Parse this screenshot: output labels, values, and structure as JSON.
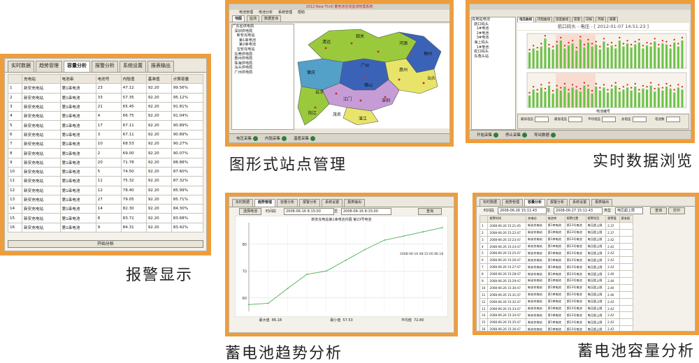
{
  "captions": {
    "alarm": "报警显示",
    "map": "图形式站点管理",
    "realtime": "实时数据浏览",
    "trend": "蓄电池趋势分析",
    "capacity": "蓄电池容量分析"
  },
  "alarm_panel": {
    "tabs": [
      "实时数据",
      "趋势管理",
      "容量分析",
      "报警分析",
      "系统设置",
      "报表输出"
    ],
    "active_tab": 2,
    "headers": [
      "",
      "充电站",
      "电池串",
      "电池号",
      "内阻值",
      "基准值",
      "计算容量"
    ],
    "rows": [
      [
        "1",
        "新安充电站",
        "第1串电池",
        "23",
        "47.12",
        "92.20",
        "99.56%"
      ],
      [
        "2",
        "新安充电站",
        "第1串电池",
        "33",
        "57.35",
        "92.20",
        "95.12%"
      ],
      [
        "3",
        "新安充电站",
        "第1串电池",
        "21",
        "65.45",
        "92.20",
        "91.81%"
      ],
      [
        "4",
        "新安充电站",
        "第1串电池",
        "4",
        "66.75",
        "92.20",
        "91.04%"
      ],
      [
        "5",
        "新安充电站",
        "第1串电池",
        "17",
        "67.11",
        "92.20",
        "90.89%"
      ],
      [
        "6",
        "新安充电站",
        "第1串电池",
        "3",
        "67.11",
        "92.20",
        "90.89%"
      ],
      [
        "7",
        "新安充电站",
        "第1串电池",
        "10",
        "68.53",
        "92.20",
        "90.27%"
      ],
      [
        "8",
        "新安充电站",
        "第1串电池",
        "2",
        "69.00",
        "92.20",
        "90.07%"
      ],
      [
        "9",
        "新安充电站",
        "第1串电池",
        "20",
        "71.78",
        "92.20",
        "88.88%"
      ],
      [
        "10",
        "新安充电站",
        "第1串电池",
        "5",
        "74.50",
        "92.20",
        "87.60%"
      ],
      [
        "11",
        "新安充电站",
        "第1串电池",
        "11",
        "75.32",
        "92.20",
        "87.32%"
      ],
      [
        "12",
        "新安充电站",
        "第1串电池",
        "12",
        "78.40",
        "92.20",
        "85.99%"
      ],
      [
        "13",
        "新安充电站",
        "第1串电池",
        "27",
        "79.05",
        "92.20",
        "85.71%"
      ],
      [
        "14",
        "新安充电站",
        "第1串电池",
        "14",
        "82.30",
        "92.20",
        "84.30%"
      ],
      [
        "15",
        "新安充电站",
        "第1串电池",
        "8",
        "83.72",
        "92.20",
        "83.68%"
      ],
      [
        "16",
        "新安充电站",
        "第1串电池",
        "9",
        "84.31",
        "92.20",
        "83.42%"
      ]
    ],
    "start_button": "开始分析"
  },
  "map_panel": {
    "title": "2012 New Thrill 蓄电池在线监测管理系统",
    "menu": [
      "电池管理",
      "电池分析",
      "系统管理",
      "帮助"
    ],
    "tabs": [
      "地图",
      "监测",
      "数据查询"
    ],
    "tree": [
      "广东省供电局",
      "  深圳供电局",
      "    新安充电站",
      "      第1串电池",
      "      第2串电池",
      "    宝安充电站",
      "  东莞供电局",
      "  惠州供电局",
      "  珠海供电局",
      "  汕头供电局",
      "  广州供电局"
    ],
    "map_labels": [
      "清远",
      "韶关",
      "河源",
      "梅州",
      "肇庆",
      "广州",
      "惠州",
      "汕头",
      "云浮",
      "佛山",
      "江门",
      "深圳",
      "阳江",
      "茂名",
      "湛江"
    ],
    "status_buttons": [
      "电压采集",
      "内阻采集",
      "温度采集"
    ],
    "colors": {
      "sea": "#ffffff",
      "region_a": "#3a63b8",
      "region_b": "#9aca3c",
      "region_c": "#53a0c8",
      "region_d": "#e8e46a",
      "region_e": "#c69cd6"
    }
  },
  "realtime_panel": {
    "tabs": [
      "电压曲线",
      "内阻曲线",
      "温度曲线",
      "容量",
      "日报",
      "月报",
      "报警"
    ],
    "header": "航口码头 - 电压 - [ 2012-01-07 14:51:23 ]",
    "tree": [
      "充电站电池",
      "  航口码头",
      "    1#电池",
      "    2#电池",
      "    3#电池",
      "  海上码头",
      "    1#电池",
      "  蛇口码头",
      "  东角头站"
    ],
    "x_label": "电池编号",
    "fields": [
      "最高电压",
      "最低电压",
      "平均电压",
      "总电压",
      "电池数"
    ],
    "status_buttons": [
      "开始采集",
      "停止采集",
      "导出数据"
    ]
  },
  "trend_panel": {
    "tabs": [
      "实时数据",
      "趋势管理",
      "容量分析",
      "报警分析",
      "系统设置",
      "报表输出"
    ],
    "active_tab": 1,
    "select_button": "选择电池",
    "time_label": "时间段",
    "start_time": "2008-06-16 8:15:00",
    "to_label": "至",
    "end_time": "2008-06-16 8:15:00",
    "query_button": "查询",
    "chart_title": "新安充电站第1串电池内阻 第23号电池",
    "annotation": "2008-06-16 08:15:00 86.18",
    "stats": [
      "最大值  86.18",
      "最小值  57.53",
      "平均值  72.80"
    ]
  },
  "capacity_panel": {
    "tabs": [
      "实时数据",
      "趋势管理",
      "容量分析",
      "报警分析",
      "系统设置",
      "报表输出"
    ],
    "active_tab": 2,
    "time_label": "时间段",
    "start_time": "2008-06-26 15:11:43",
    "to_label": "至",
    "end_time": "2008-06-27 15:11:43",
    "type_label": "类型",
    "type_value": "电压超上限",
    "query_button": "查询",
    "print_button": "打印",
    "headers": [
      "",
      "报警时间",
      "充电站",
      "电池串",
      "报警位置",
      "报警项目",
      "报警值",
      "基准值"
    ],
    "rows": [
      [
        "1",
        "2008-06-26 15:21:45",
        "新安充电站",
        "第1串电池",
        "第23号电池",
        "电压超上限",
        "2.37",
        ""
      ],
      [
        "2",
        "2008-06-26 15:22:47",
        "新安充电站",
        "第1串电池",
        "第23号电池",
        "电压超上限",
        "2.37",
        ""
      ],
      [
        "3",
        "2008-06-26 15:23:47",
        "新安充电站",
        "第1串电池",
        "第23号电池",
        "电压超上限",
        "2.42",
        ""
      ],
      [
        "4",
        "2008-06-26 15:24:47",
        "新安充电站",
        "第1串电池",
        "第23号电池",
        "电压超上限",
        "2.42",
        ""
      ],
      [
        "5",
        "2008-06-26 15:25:47",
        "新安充电站",
        "第1串电池",
        "第23号电池",
        "电压超上限",
        "2.42",
        ""
      ],
      [
        "6",
        "2008-06-26 15:26:47",
        "新安充电站",
        "第1串电池",
        "第23号电池",
        "电压超上限",
        "2.42",
        ""
      ],
      [
        "7",
        "2008-06-26 15:27:47",
        "新安充电站",
        "第1串电池",
        "第23号电池",
        "电压超上限",
        "2.42",
        ""
      ],
      [
        "8",
        "2008-06-26 15:28:47",
        "新安充电站",
        "第1串电池",
        "第23号电池",
        "电压超上限",
        "2.40",
        ""
      ],
      [
        "9",
        "2008-06-26 15:29:47",
        "新安充电站",
        "第1串电池",
        "第23号电池",
        "电压超上限",
        "2.40",
        ""
      ],
      [
        "10",
        "2008-06-26 15:30:47",
        "新安充电站",
        "第1串电池",
        "第23号电池",
        "电压超上限",
        "2.40",
        ""
      ],
      [
        "11",
        "2008-06-26 15:31:47",
        "新安充电站",
        "第1串电池",
        "第23号电池",
        "电压超上限",
        "2.46",
        ""
      ],
      [
        "12",
        "2008-06-26 15:32:47",
        "新安充电站",
        "第1串电池",
        "第23号电池",
        "电压超上限",
        "2.42",
        ""
      ],
      [
        "13",
        "2008-06-26 15:33:47",
        "新安充电站",
        "第1串电池",
        "第23号电池",
        "电压超上限",
        "2.42",
        ""
      ],
      [
        "14",
        "2008-06-26 15:34:47",
        "新安充电站",
        "第1串电池",
        "第23号电池",
        "电压超上限",
        "2.42",
        ""
      ],
      [
        "15",
        "2008-06-26 15:35:47",
        "新安充电站",
        "第1串电池",
        "第23号电池",
        "电压超上限",
        "2.42",
        ""
      ],
      [
        "16",
        "2008-06-26 15:36:47",
        "新安充电站",
        "第1串电池",
        "第23号电池",
        "电压超上限",
        "2.42",
        ""
      ]
    ]
  },
  "chart_data": [
    {
      "type": "line",
      "title": "新安充电站第1串电池内阻 第23号电池",
      "xlabel": "",
      "ylabel": "",
      "x": [
        1,
        2,
        3,
        4,
        5,
        6,
        7,
        8,
        9,
        10,
        11
      ],
      "series": [
        {
          "values": [
            57.53,
            58.0,
            63.5,
            68.8,
            70.0,
            74.0,
            78.0,
            81.5,
            83.0,
            84.6,
            86.18
          ]
        }
      ],
      "ylim": [
        55,
        88
      ],
      "yticks": [
        60,
        70,
        80
      ],
      "grid": true
    },
    {
      "type": "scatter",
      "title": "航口码头 - 电压",
      "xlabel": "电池编号",
      "ylabel": "",
      "series": [
        {
          "values": [
            2.16,
            2.2,
            2.18,
            2.22,
            2.3,
            2.21,
            2.19,
            2.24,
            2.28,
            2.2,
            2.23,
            2.25,
            2.18,
            2.29,
            2.21,
            2.26,
            2.22,
            2.24,
            2.19,
            2.27,
            2.21,
            2.23,
            2.2,
            2.28,
            2.22,
            2.25,
            2.21,
            2.24,
            2.26,
            2.2,
            2.23,
            2.22,
            2.27,
            2.21,
            2.25,
            2.24,
            2.2,
            2.26,
            2.22,
            2.28
          ]
        },
        {
          "values": [
            2.12,
            2.18,
            2.15,
            2.2,
            2.16,
            2.22,
            2.14,
            2.19,
            2.17,
            2.21,
            2.15,
            2.2,
            2.18,
            2.16,
            2.22,
            2.19,
            2.14,
            2.21,
            2.17,
            2.2,
            2.15,
            2.19,
            2.22,
            2.16,
            2.18,
            2.2,
            2.17,
            2.21,
            2.15,
            2.19,
            2.18,
            2.22,
            2.16,
            2.2,
            2.17,
            2.21,
            2.19,
            2.15,
            2.2,
            2.18
          ]
        }
      ],
      "ylim": [
        2.0,
        2.35
      ],
      "grid": true
    }
  ]
}
